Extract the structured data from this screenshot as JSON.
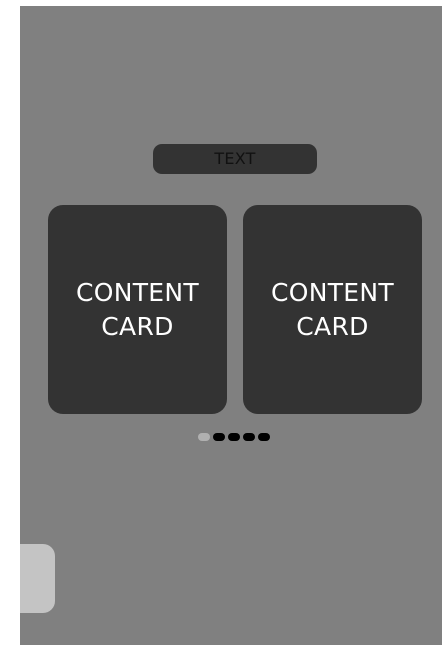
{
  "header": {
    "label": "TEXT"
  },
  "cards": [
    {
      "line1": "CONTENT",
      "line2": "CARD"
    },
    {
      "line1": "CONTENT",
      "line2": "CARD"
    }
  ],
  "pagination": {
    "total": 5,
    "active_index": 0
  },
  "colors": {
    "background": "#808080",
    "card": "#333333",
    "dot_active": "#b0b0b0",
    "dot_inactive": "#000000",
    "side_tab": "#c4c4c4"
  }
}
